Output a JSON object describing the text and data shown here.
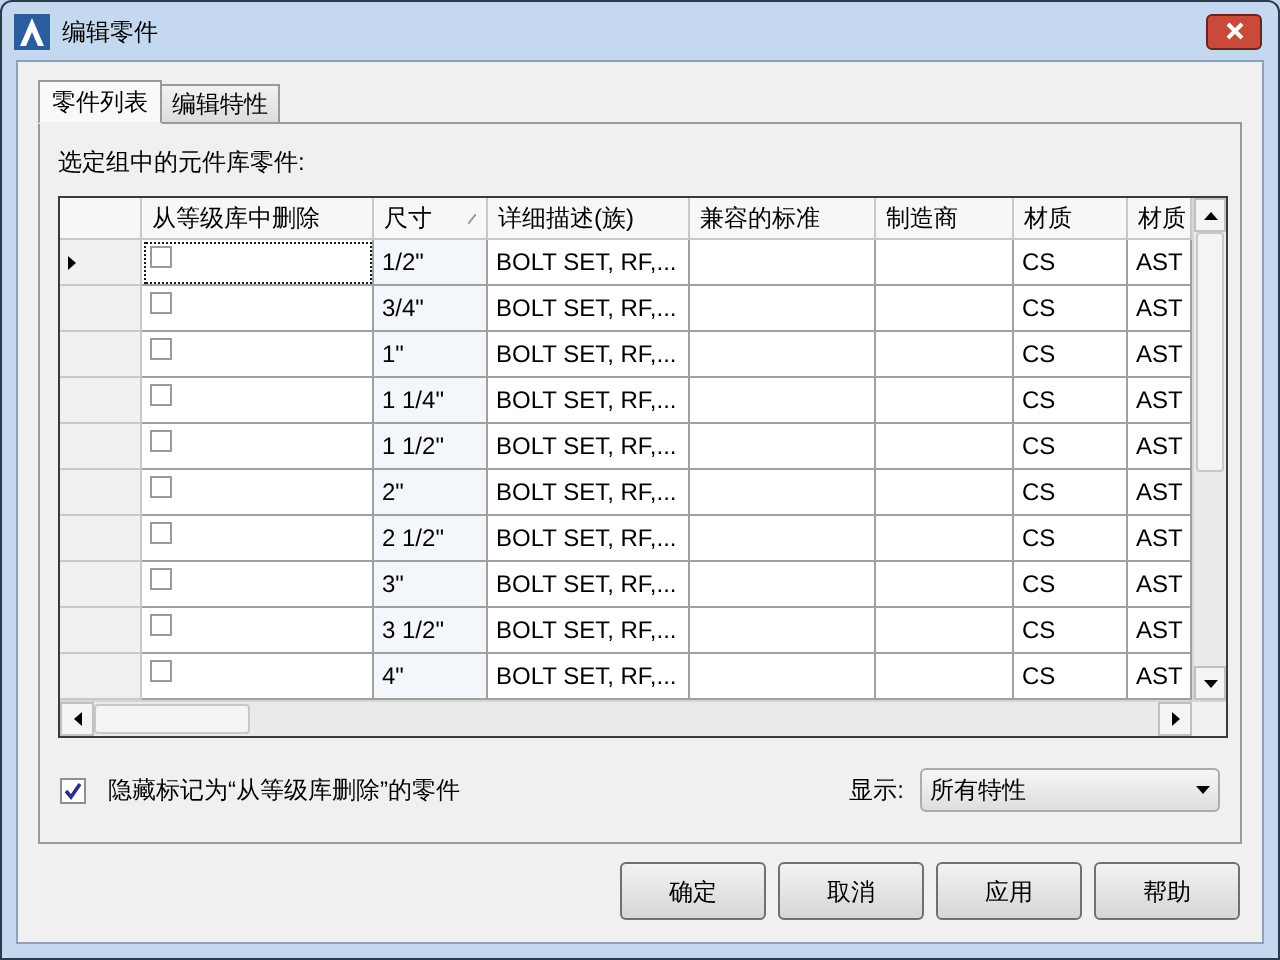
{
  "window": {
    "title": "编辑零件"
  },
  "tabs": [
    {
      "label": "零件列表",
      "selected": true
    },
    {
      "label": "编辑特性",
      "selected": false
    }
  ],
  "grid_label": "选定组中的元件库零件:",
  "table": {
    "columns": [
      {
        "label": "从等级库中删除",
        "sorted": false
      },
      {
        "label": "尺寸",
        "sorted": true
      },
      {
        "label": "详细描述(族)",
        "sorted": false
      },
      {
        "label": "兼容的标准",
        "sorted": false
      },
      {
        "label": "制造商",
        "sorted": false
      },
      {
        "label": "材质",
        "sorted": false
      },
      {
        "label": "材质",
        "sorted": false
      }
    ],
    "rows": [
      {
        "current": true,
        "remove": false,
        "size": "1/2\"",
        "description": "BOLT SET, RF,...",
        "material": "CS",
        "column_7": "AST"
      },
      {
        "current": false,
        "remove": false,
        "size": "3/4\"",
        "description": "BOLT SET, RF,...",
        "material": "CS",
        "column_7": "AST"
      },
      {
        "current": false,
        "remove": false,
        "size": "1\"",
        "description": "BOLT SET, RF,...",
        "material": "CS",
        "column_7": "AST"
      },
      {
        "current": false,
        "remove": false,
        "size": "1 1/4\"",
        "description": "BOLT SET, RF,...",
        "material": "CS",
        "column_7": "AST"
      },
      {
        "current": false,
        "remove": false,
        "size": "1 1/2\"",
        "description": "BOLT SET, RF,...",
        "material": "CS",
        "column_7": "AST"
      },
      {
        "current": false,
        "remove": false,
        "size": "2\"",
        "description": "BOLT SET, RF,...",
        "material": "CS",
        "column_7": "AST"
      },
      {
        "current": false,
        "remove": false,
        "size": "2 1/2\"",
        "description": "BOLT SET, RF,...",
        "material": "CS",
        "column_7": "AST"
      },
      {
        "current": false,
        "remove": false,
        "size": "3\"",
        "description": "BOLT SET, RF,...",
        "material": "CS",
        "column_7": "AST"
      },
      {
        "current": false,
        "remove": false,
        "size": "3 1/2\"",
        "description": "BOLT SET, RF,...",
        "material": "CS",
        "column_7": "AST"
      },
      {
        "current": false,
        "remove": false,
        "size": "4\"",
        "description": "BOLT SET, RF,...",
        "material": "CS",
        "column_7": "AST"
      }
    ]
  },
  "hide_option": {
    "label": "隐藏标记为“从等级库删除”的零件",
    "checked": true
  },
  "display": {
    "label": "显示:",
    "value": "所有特性"
  },
  "buttons": [
    "确定",
    "取消",
    "应用",
    "帮助"
  ]
}
